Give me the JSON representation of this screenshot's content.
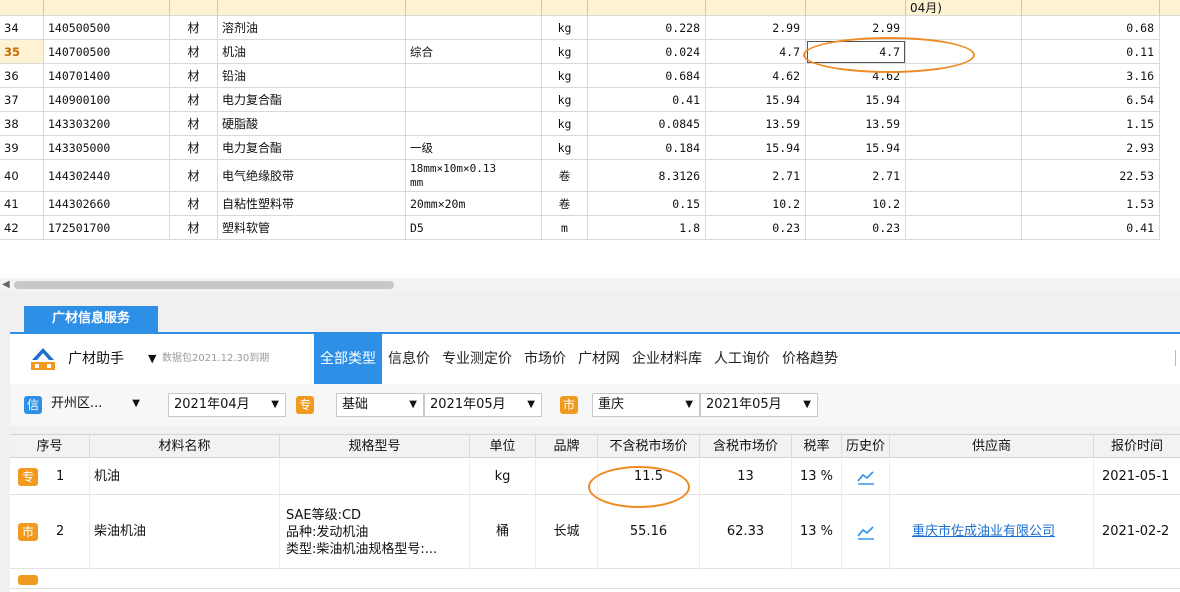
{
  "grid": {
    "header_fragment": "04月)",
    "rows": [
      {
        "row_no": "34",
        "code": "140500500",
        "type": "材",
        "name": "溶剂油",
        "spec": "",
        "unit": "kg",
        "qty": "0.228",
        "price1": "2.99",
        "price2": "2.99",
        "price3": "",
        "amount": "0.68"
      },
      {
        "row_no": "35",
        "code": "140700500",
        "type": "材",
        "name": "机油",
        "spec": "综合",
        "unit": "kg",
        "qty": "0.024",
        "price1": "4.7",
        "price2": "4.7",
        "price3": "",
        "amount": "0.11"
      },
      {
        "row_no": "36",
        "code": "140701400",
        "type": "材",
        "name": "铅油",
        "spec": "",
        "unit": "kg",
        "qty": "0.684",
        "price1": "4.62",
        "price2": "4.62",
        "price3": "",
        "amount": "3.16"
      },
      {
        "row_no": "37",
        "code": "140900100",
        "type": "材",
        "name": "电力复合酯",
        "spec": "",
        "unit": "kg",
        "qty": "0.41",
        "price1": "15.94",
        "price2": "15.94",
        "price3": "",
        "amount": "6.54"
      },
      {
        "row_no": "38",
        "code": "143303200",
        "type": "材",
        "name": "硬脂酸",
        "spec": "",
        "unit": "kg",
        "qty": "0.0845",
        "price1": "13.59",
        "price2": "13.59",
        "price3": "",
        "amount": "1.15"
      },
      {
        "row_no": "39",
        "code": "143305000",
        "type": "材",
        "name": "电力复合酯",
        "spec": "一级",
        "unit": "kg",
        "qty": "0.184",
        "price1": "15.94",
        "price2": "15.94",
        "price3": "",
        "amount": "2.93"
      },
      {
        "row_no": "40",
        "code": "144302440",
        "type": "材",
        "name": "电气绝缘胶带",
        "spec": "18mm×10m×0.13",
        "spec2": "mm",
        "unit": "卷",
        "qty": "8.3126",
        "price1": "2.71",
        "price2": "2.71",
        "price3": "",
        "amount": "22.53"
      },
      {
        "row_no": "41",
        "code": "144302660",
        "type": "材",
        "name": "自粘性塑料带",
        "spec": "20mm×20m",
        "unit": "卷",
        "qty": "0.15",
        "price1": "10.2",
        "price2": "10.2",
        "price3": "",
        "amount": "1.53"
      },
      {
        "row_no": "42",
        "code": "172501700",
        "type": "材",
        "name": "塑料软管",
        "spec": "D5",
        "unit": "m",
        "qty": "1.8",
        "price1": "0.23",
        "price2": "0.23",
        "price3": "",
        "amount": "0.41"
      }
    ]
  },
  "panel": {
    "tab_label": "广材信息服务",
    "brand": "广材助手",
    "data_note": "数据包2021.12.30到期",
    "tabs": [
      "全部类型",
      "信息价",
      "专业测定价",
      "市场价",
      "广材网",
      "企业材料库",
      "人工询价",
      "价格趋势"
    ],
    "filters": {
      "badge1": "信",
      "region": "开州区...",
      "period1": "2021年04月",
      "badge2": "专",
      "category": "基础",
      "period2": "2021年05月",
      "badge3": "市",
      "city": "重庆",
      "period3": "2021年05月"
    }
  },
  "results": {
    "columns": [
      "序号",
      "材料名称",
      "规格型号",
      "单位",
      "品牌",
      "不含税市场价",
      "含税市场价",
      "税率",
      "历史价",
      "供应商",
      "报价时间"
    ],
    "rows": [
      {
        "badge": "专",
        "no": "1",
        "name": "机油",
        "spec_lines": [],
        "unit": "kg",
        "brand": "",
        "price_ex_tax": "11.5",
        "price_inc_tax": "13",
        "tax_rate": "13 %",
        "supplier": "",
        "quote_time": "2021-05-1"
      },
      {
        "badge": "市",
        "no": "2",
        "name": "柴油机油",
        "spec_lines": [
          "SAE等级:CD",
          "品种:发动机油",
          "类型:柴油机油规格型号:..."
        ],
        "unit": "桶",
        "brand": "长城",
        "price_ex_tax": "55.16",
        "price_inc_tax": "62.33",
        "tax_rate": "13 %",
        "supplier": "重庆市佐成油业有限公司",
        "quote_time": "2021-02-2"
      }
    ]
  },
  "colors": {
    "accent": "#2e8fe6",
    "badge_orange": "#f19a20",
    "annotation": "#f08a24"
  }
}
